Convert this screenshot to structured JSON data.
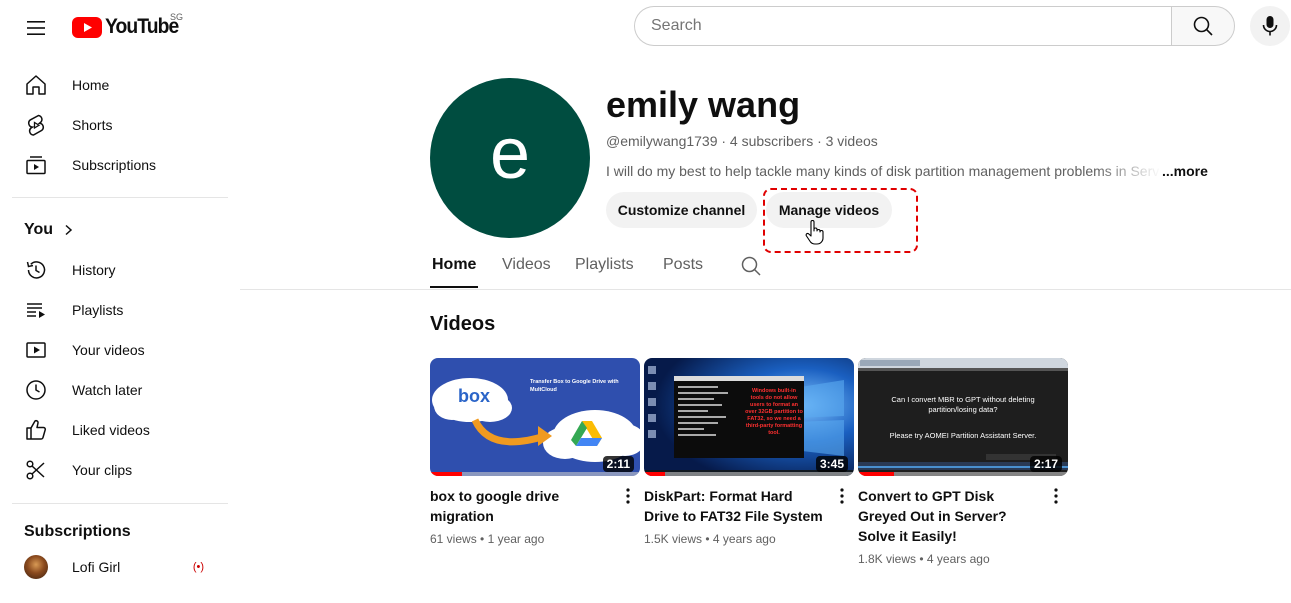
{
  "topbar": {
    "logo_text": "YouTube",
    "country_code": "SG",
    "search_placeholder": "Search",
    "search_value": ""
  },
  "sidebar": {
    "main": [
      {
        "label": "Home",
        "icon": "home-icon"
      },
      {
        "label": "Shorts",
        "icon": "shorts-icon"
      },
      {
        "label": "Subscriptions",
        "icon": "subscriptions-icon"
      }
    ],
    "you_heading": "You",
    "you_items": [
      {
        "label": "History",
        "icon": "history-icon"
      },
      {
        "label": "Playlists",
        "icon": "playlists-icon"
      },
      {
        "label": "Your videos",
        "icon": "your-videos-icon"
      },
      {
        "label": "Watch later",
        "icon": "watch-later-icon"
      },
      {
        "label": "Liked videos",
        "icon": "liked-videos-icon"
      },
      {
        "label": "Your clips",
        "icon": "clips-icon"
      }
    ],
    "subscriptions_heading": "Subscriptions",
    "subscriptions": [
      {
        "label": "Lofi Girl",
        "live": true
      }
    ]
  },
  "channel": {
    "avatar_letter": "e",
    "avatar_color": "#004d40",
    "name": "emily wang",
    "meta": "@emilywang1739 · 4 subscribers · 3 videos",
    "description": "I will do my best to help tackle many kinds of disk partition management problems in Server",
    "more_label": "...more",
    "customize_label": "Customize channel",
    "manage_label": "Manage videos"
  },
  "tabs": [
    {
      "label": "Home",
      "active": true
    },
    {
      "label": "Videos",
      "active": false
    },
    {
      "label": "Playlists",
      "active": false
    },
    {
      "label": "Posts",
      "active": false
    }
  ],
  "videos_section": {
    "title": "Videos",
    "items": [
      {
        "title": "box to google drive migration",
        "views": "61 views",
        "age": "1 year ago",
        "duration": "2:11",
        "progress": 0.15,
        "thumb_heading": "Transfer Box to Google Drive with MultCloud",
        "thumb_logo": "box"
      },
      {
        "title": "DiskPart: Format Hard Drive to FAT32 File System",
        "views": "1.5K views",
        "age": "4 years ago",
        "duration": "3:45",
        "progress": 0.1,
        "thumb_text": "Windows built-in tools do not allow users to format an over 32GB partition to FAT32, so we need a third-party formatting tool."
      },
      {
        "title": "Convert to GPT Disk Greyed Out in Server? Solve it Easily!",
        "views": "1.8K views",
        "age": "4 years ago",
        "duration": "2:17",
        "progress": 0.17,
        "thumb_line1": "Can I convert MBR to GPT without deleting partition/losing data?",
        "thumb_line2": "Please  try AOMEI Partition Assistant Server."
      }
    ]
  },
  "colors": {
    "brand_red": "#ff0000",
    "highlight": "#e00000"
  }
}
